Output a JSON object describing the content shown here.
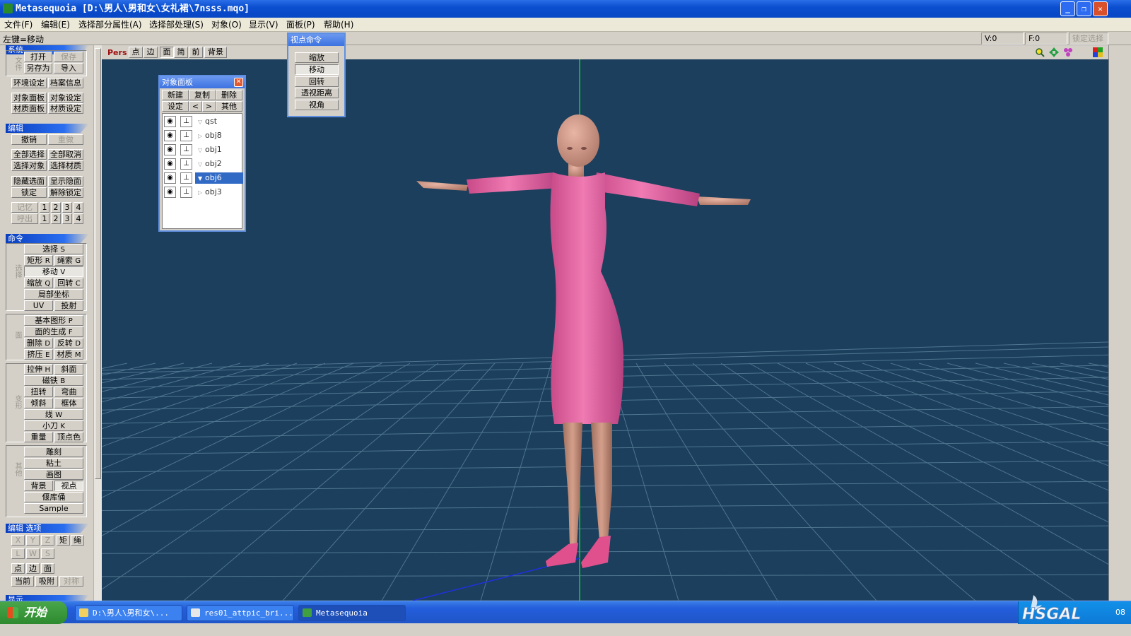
{
  "window": {
    "title": "Metasequoia [D:\\男人\\男和女\\女礼裙\\7nsss.mqo]"
  },
  "menu": [
    "文件(F)",
    "编辑(E)",
    "选择部分属性(A)",
    "选择部处理(S)",
    "对象(O)",
    "显示(V)",
    "面板(P)",
    "帮助(H)"
  ],
  "status": {
    "hint": "左键=移动",
    "v": "V:0",
    "f": "F:0",
    "lock": "锁定选择"
  },
  "left": {
    "system_head": "系统",
    "file_label": "文件",
    "open": "打开",
    "save": "保存",
    "saveas": "另存为",
    "import": "导入",
    "env": "环境设定",
    "fileinfo": "档案信息",
    "objpanel": "对象面板",
    "objset": "对象设定",
    "matpanel": "材质面板",
    "matset": "材质设定",
    "edit_head": "编辑",
    "undo": "撤销",
    "redo": "重做",
    "selall": "全部选择",
    "deselall": "全部取消",
    "selobj": "选择对象",
    "selmat": "选择材质",
    "hidesel": "隐藏选面",
    "showhide": "显示隐面",
    "lock": "锁定",
    "unlock": "解除锁定",
    "memory": "记忆",
    "recall": "呼出",
    "n1": "1",
    "n2": "2",
    "n3": "3",
    "n4": "4",
    "cmd_head": "命令",
    "label_select": "选择",
    "select": "选择",
    "select_k": "S",
    "rect": "矩形",
    "rect_k": "R",
    "lasso": "绳索",
    "lasso_k": "G",
    "move": "移动",
    "move_k": "V",
    "scale": "缩放",
    "scale_k": "Q",
    "rotate": "回转",
    "rotate_k": "C",
    "localcoord": "局部坐标",
    "uv": "UV",
    "project": "投射",
    "label_face": "面",
    "basic": "基本图形",
    "basic_k": "P",
    "facegen": "面的生成",
    "facegen_k": "F",
    "delete": "删除",
    "delete_k": "D",
    "flip": "反转",
    "flip_k": "D",
    "extrude": "挤压",
    "extrude_k": "E",
    "material": "材质",
    "material_k": "M",
    "label_deform": "变形",
    "stretch": "拉伸",
    "stretch_k": "H",
    "bevel": "斜面",
    "magnet": "磁铁",
    "magnet_k": "B",
    "twist": "扭转",
    "bend": "弯曲",
    "tilt": "倾斜",
    "lattice": "框体",
    "line": "线",
    "line_k": "W",
    "knife": "小刀",
    "knife_k": "K",
    "weight": "重量",
    "vcolor": "顶点色",
    "label_misc": "其他",
    "sculpt": "雕刻",
    "clay": "粘土",
    "paint": "画图",
    "bg": "背景",
    "viewpoint": "视点",
    "gnome": "偃库俑",
    "sample": "Sample",
    "editopt_head": "编辑 选项",
    "x": "X",
    "y": "Y",
    "z": "Z",
    "rect2": "矩",
    "rope": "绳",
    "l": "L",
    "w": "W",
    "s": "S",
    "pt": "点",
    "edge": "边",
    "face": "面",
    "current": "当前",
    "snap": "吸附",
    "sym": "对称",
    "display_head": "显示"
  },
  "viewbar": {
    "pers": "Pers",
    "pt": "点",
    "edge": "边",
    "face": "面",
    "simple": "简",
    "front": "前",
    "bg": "背景",
    "icons": [
      "zoom-icon",
      "move-view-icon",
      "rotate-view-icon",
      "color-grid-icon"
    ]
  },
  "objpanel": {
    "title": "对象面板",
    "new": "新建",
    "copy": "复制",
    "delete": "删除",
    "settings": "设定",
    "prev": "<",
    "next": ">",
    "other": "其他",
    "objects": [
      "qst",
      "obj8",
      "obj1",
      "obj2",
      "obj6",
      "obj3"
    ],
    "selected": "obj6"
  },
  "vppanel": {
    "title": "视点命令",
    "zoom": "缩放",
    "move": "移动",
    "rotate": "回转",
    "persp": "透视距离",
    "angle": "视角"
  },
  "taskbar": {
    "start": "开始",
    "tasks": [
      "D:\\男人\\男和女\\...",
      "res01_attpic_bri...",
      "Metasequoia"
    ],
    "clock": "08"
  },
  "colors": {
    "viewport": "#1b3f5d",
    "grid": "#5a7f96",
    "dress": "#e8649e",
    "skin": "#c98f80",
    "titlebar": "#0b4fd0"
  }
}
